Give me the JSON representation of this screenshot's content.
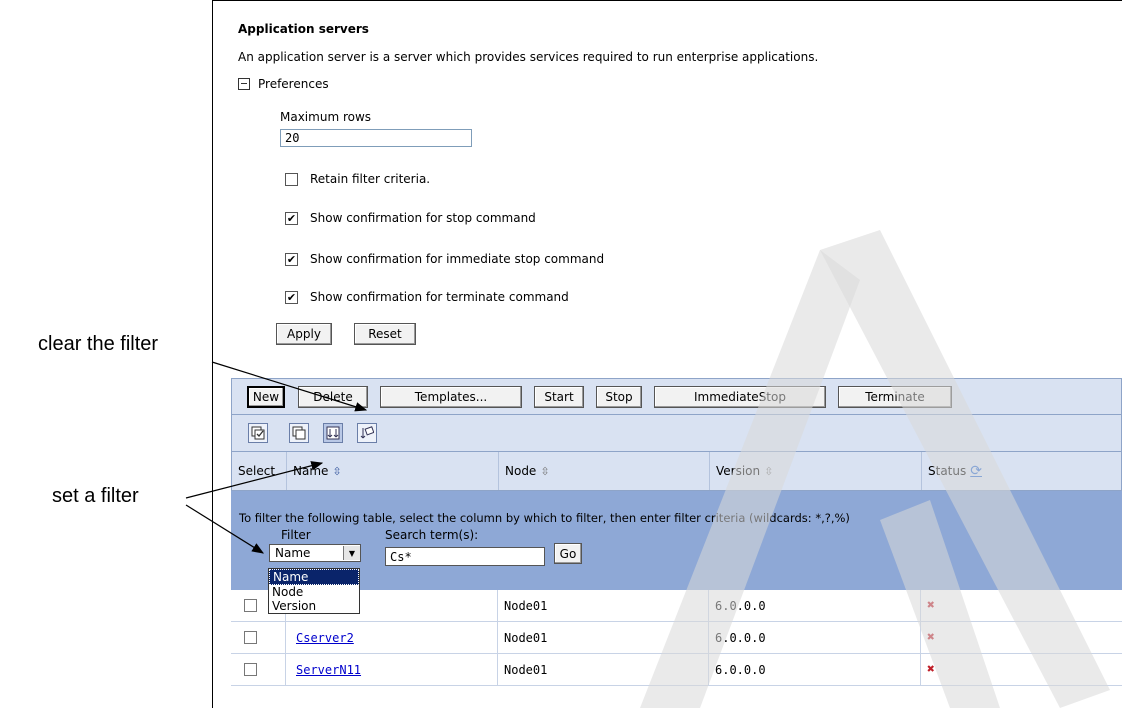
{
  "page": {
    "title": "Application servers",
    "description": "An application server is a server which provides services required to run enterprise applications.",
    "preferences_label": "Preferences"
  },
  "preferences": {
    "max_rows_label": "Maximum rows",
    "max_rows_value": "20",
    "checkboxes": [
      {
        "label": "Retain filter criteria.",
        "checked": false,
        "mark": ""
      },
      {
        "label": "Show confirmation for stop command",
        "checked": true,
        "mark": "✔"
      },
      {
        "label": "Show confirmation for immediate stop command",
        "checked": true,
        "mark": "✔"
      },
      {
        "label": "Show confirmation for terminate command",
        "checked": true,
        "mark": "✔"
      }
    ],
    "apply_label": "Apply",
    "reset_label": "Reset"
  },
  "toolbar": {
    "new": "New",
    "delete": "Delete",
    "templates": "Templates...",
    "start": "Start",
    "stop": "Stop",
    "immediate_stop": "ImmediateStop",
    "terminate": "Terminate"
  },
  "icons": [
    "select-all-icon",
    "deselect-all-icon",
    "show-filter-icon",
    "clear-filter-icon"
  ],
  "table": {
    "headers": {
      "select": "Select",
      "name": "Name",
      "node": "Node",
      "version": "Version",
      "status": "Status"
    },
    "sort_glyph": "⇳",
    "refresh_glyph": "⟳",
    "filter_instructions": "To filter the following table, select the column by which to filter, then enter filter criteria (wildcards: *,?,%)",
    "filter_label": "Filter",
    "search_label": "Search term(s):",
    "filter_selected": "Name",
    "filter_options": [
      "Name",
      "Node",
      "Version"
    ],
    "search_value": "Cs*",
    "go_label": "Go",
    "rows": [
      {
        "name": "",
        "node": "Node01",
        "version": "6.0.0.0",
        "status": "stopped"
      },
      {
        "name": "Cserver2",
        "node": "Node01",
        "version": "6.0.0.0",
        "status": "stopped"
      },
      {
        "name": "ServerN11",
        "node": "Node01",
        "version": "6.0.0.0",
        "status": "stopped"
      }
    ]
  },
  "callouts": {
    "clear_filter": "clear the filter",
    "set_filter": "set a filter"
  },
  "colors": {
    "table_header_bg": "#d9e2f2",
    "filter_band_bg": "#8ea8d6",
    "link": "#0000cc",
    "status_stopped": "#c0202a"
  }
}
